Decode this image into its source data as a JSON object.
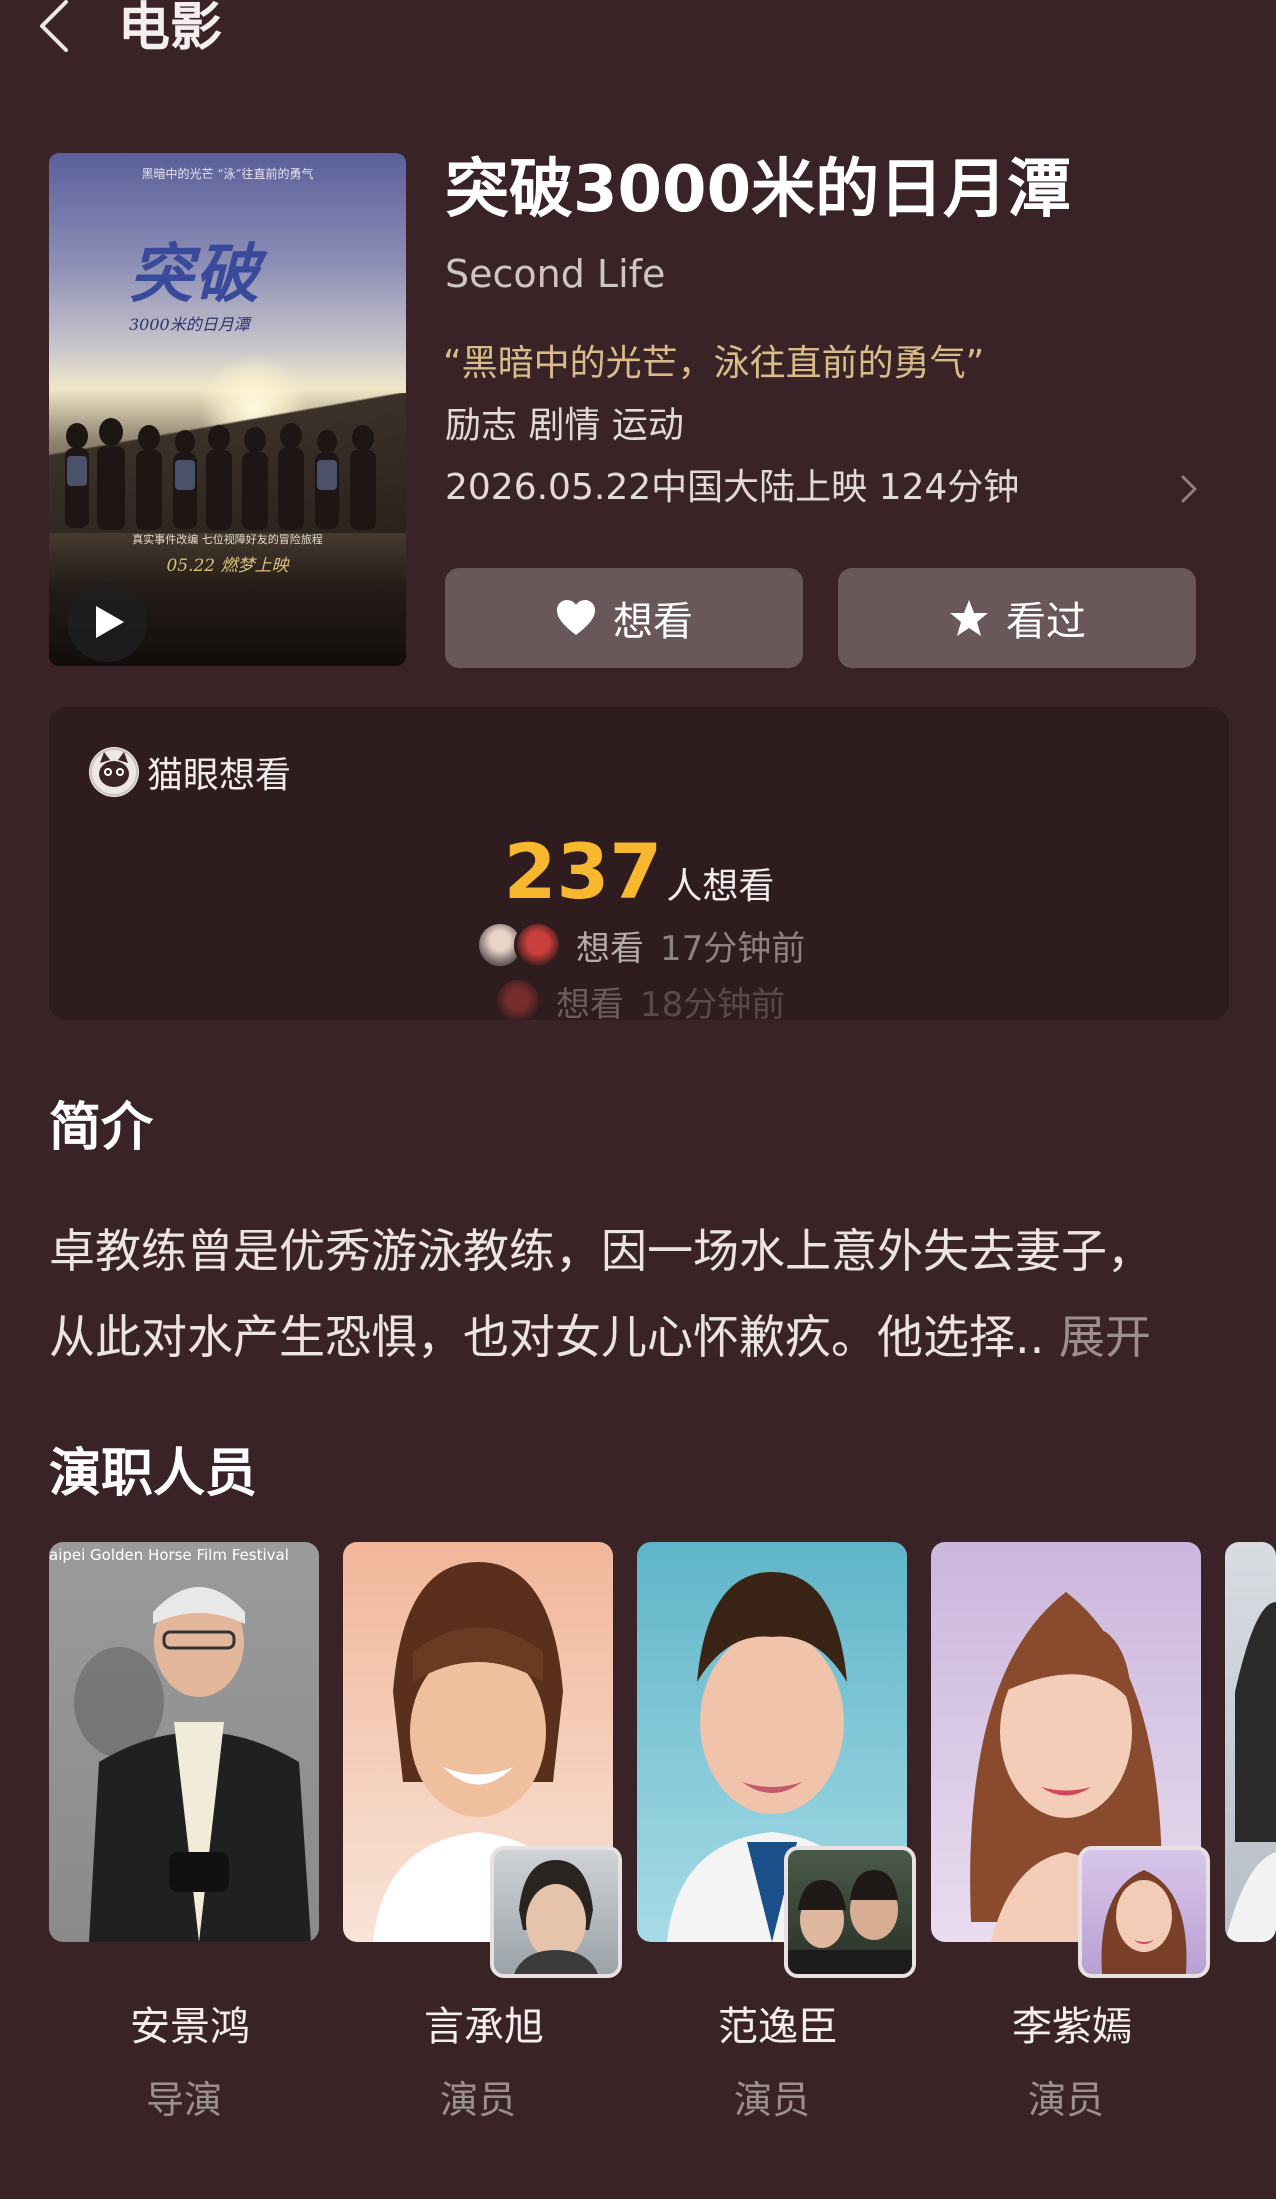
{
  "header": {
    "title": "电影",
    "back_icon": "chevron-left-icon"
  },
  "movie": {
    "title": "突破3000米的日月潭",
    "english_title": "Second Life",
    "tagline": "“黑暗中的光芒，泳往直前的勇气”",
    "genres": "励志 剧情 运动",
    "release_info": "2026.05.22中国大陆上映 124分钟",
    "poster": {
      "top_text": "黑暗中的光芒 “泳”往直前的勇气",
      "calligraphy": "突破",
      "subtitle": "3000米的日月潭",
      "bottom_text": "真实事件改编 七位视障好友的冒险旅程",
      "date_text": "05.22 燃梦上映"
    }
  },
  "actions": {
    "want_label": "想看",
    "seen_label": "看过",
    "want_icon": "heart-icon",
    "seen_icon": "star-icon"
  },
  "maoyan": {
    "label": "猫眼想看",
    "icon": "cat-icon",
    "count": "237",
    "count_unit": "人想看",
    "feed": [
      {
        "action": "想看",
        "time": "17分钟前"
      },
      {
        "action": "想看",
        "time": "18分钟前"
      }
    ]
  },
  "synopsis": {
    "title": "简介",
    "line1": "卓教练曾是优秀游泳教练，因一场水上意外失去妻子，",
    "line2": "从此对水产生恐惧，也对女儿心怀歉疚。他选择..",
    "expand_label": "展开"
  },
  "cast": {
    "title": "演职人员",
    "members": [
      {
        "name": "安景鸿",
        "role": "导演",
        "photo_caption": "aipei Golden Horse Film Festival"
      },
      {
        "name": "言承旭",
        "role": "演员"
      },
      {
        "name": "范逸臣",
        "role": "演员"
      },
      {
        "name": "李紫嫣",
        "role": "演员"
      }
    ]
  },
  "colors": {
    "background": "#3a2327",
    "accent": "#f7b72f",
    "tagline": "#d8bc8a",
    "card": "#2e1c1f",
    "button": "#6a5759"
  }
}
